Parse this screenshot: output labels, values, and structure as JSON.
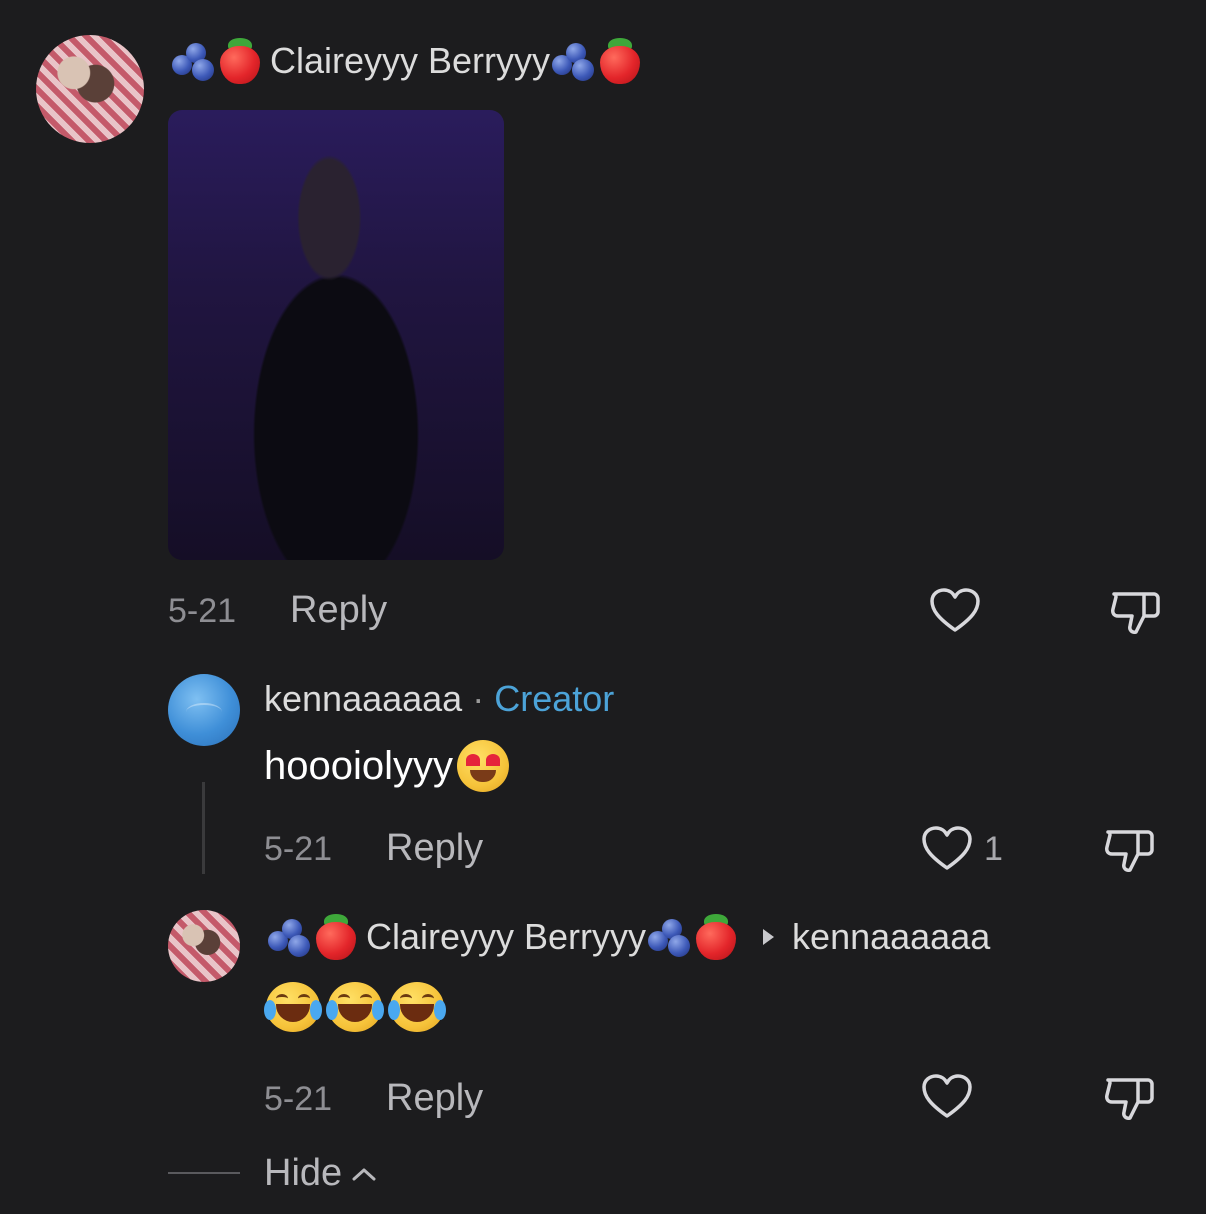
{
  "comments": [
    {
      "username": "Claireyyy Berryyy",
      "date": "5-21",
      "reply_label": "Reply",
      "has_image": true
    },
    {
      "username": "kennaaaaaa",
      "separator": "·",
      "badge": "Creator",
      "text": "hoooiolyyy",
      "date": "5-21",
      "reply_label": "Reply",
      "like_count": "1"
    },
    {
      "username": "Claireyyy Berryyy",
      "reply_to": "kennaaaaaa",
      "date": "5-21",
      "reply_label": "Reply"
    }
  ],
  "hide_label": "Hide",
  "icons": {
    "like": "heart-outline-icon",
    "dislike": "thumbs-down-outline-icon",
    "reply_arrow": "caret-right-icon",
    "collapse": "chevron-up-icon"
  },
  "colors": {
    "background": "#1c1c1e",
    "creator_badge": "#4ca3d8"
  }
}
